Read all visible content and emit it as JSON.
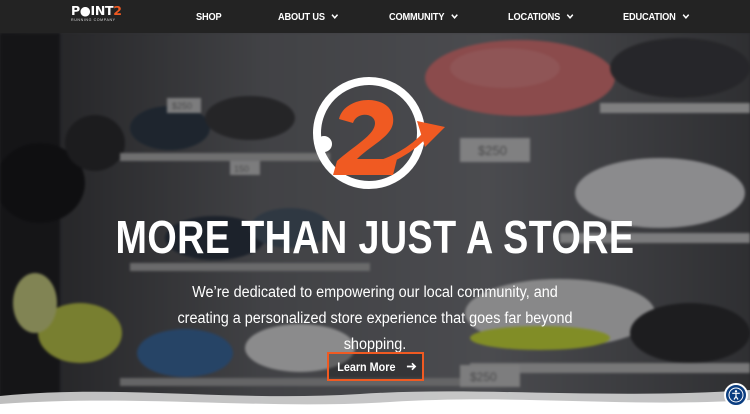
{
  "brand": {
    "word_main": "P●INT",
    "word_accent": "2",
    "tagline": "RUNNING COMPANY",
    "accent_color": "#f05a22"
  },
  "nav": {
    "items": [
      {
        "label": "SHOP",
        "has_dropdown": false
      },
      {
        "label": "ABOUT US",
        "has_dropdown": true
      },
      {
        "label": "COMMUNITY",
        "has_dropdown": true
      },
      {
        "label": "LOCATIONS",
        "has_dropdown": true
      },
      {
        "label": "EDUCATION",
        "has_dropdown": true
      }
    ]
  },
  "hero": {
    "badge_icon": "point2-logo-icon",
    "headline": "MORE THAN JUST A STORE",
    "subtext": "We’re dedicated to empowering our local community, and creating a personalized store experience that goes far beyond shopping.",
    "cta_label": "Learn More",
    "cta_icon": "arrow-right-icon",
    "price_tags": [
      "$250",
      "$250",
      "$250",
      "$250",
      "150",
      "$250"
    ]
  },
  "accessibility": {
    "icon": "accessibility-icon"
  }
}
